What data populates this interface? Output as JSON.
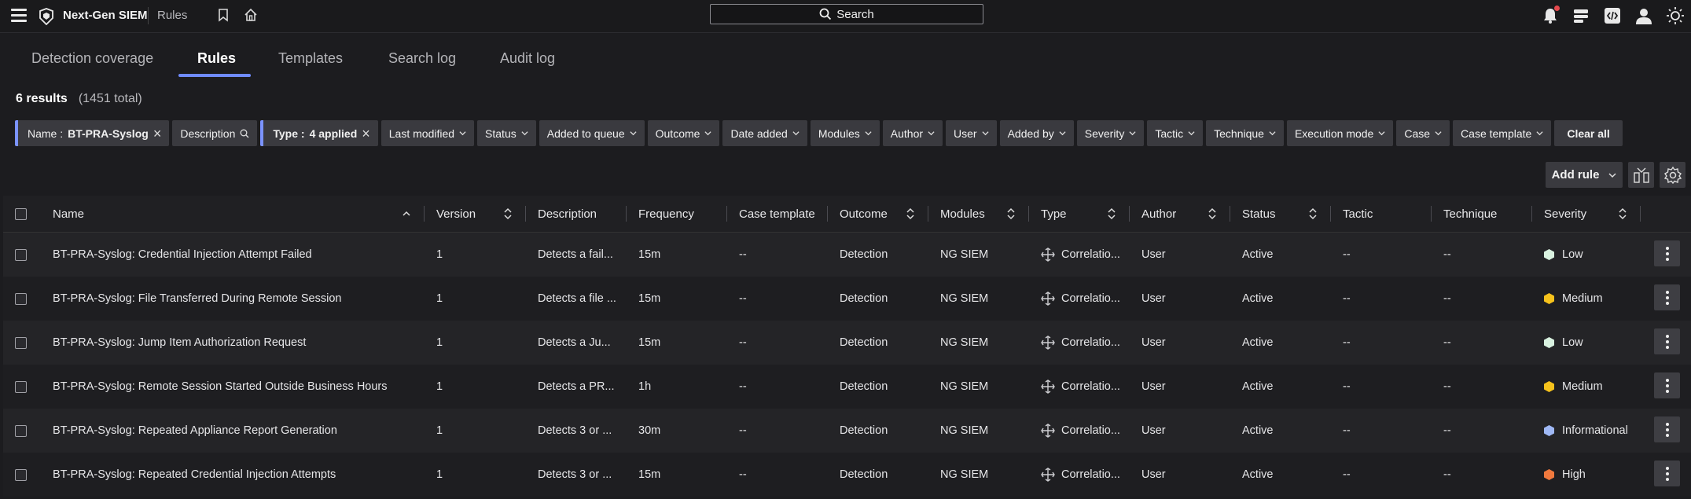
{
  "app": {
    "name": "Next-Gen SIEM",
    "section": "Rules"
  },
  "search": {
    "label": "Search"
  },
  "tabs": [
    {
      "label": "Detection coverage"
    },
    {
      "label": "Rules",
      "active": true
    },
    {
      "label": "Templates"
    },
    {
      "label": "Search log"
    },
    {
      "label": "Audit log"
    }
  ],
  "results": {
    "count": "6 results",
    "total": "(1451 total)"
  },
  "filters": {
    "name_label": "Name :",
    "name_value": "BT-PRA-Syslog",
    "description": "Description",
    "type_label": "Type :",
    "type_value": "4 applied",
    "dropdowns": [
      "Last modified",
      "Status",
      "Added to queue",
      "Outcome",
      "Date added",
      "Modules",
      "Author",
      "User",
      "Added by",
      "Severity",
      "Tactic",
      "Technique",
      "Execution mode",
      "Case",
      "Case template"
    ],
    "clear_all": "Clear all"
  },
  "actions": {
    "add_rule": "Add rule"
  },
  "table": {
    "columns": [
      "Name",
      "Version",
      "Description",
      "Frequency",
      "Case template",
      "Outcome",
      "Modules",
      "Type",
      "Author",
      "Status",
      "Tactic",
      "Technique",
      "Severity"
    ],
    "rows": [
      {
        "name": "BT-PRA-Syslog: Credential Injection Attempt Failed",
        "version": "1",
        "description": "Detects a fail...",
        "frequency": "15m",
        "case_template": "--",
        "outcome": "Detection",
        "modules": "NG SIEM",
        "type": "Correlatio...",
        "author": "User",
        "status": "Active",
        "tactic": "--",
        "technique": "--",
        "severity": "Low",
        "severity_color": "#d9f2e0"
      },
      {
        "name": "BT-PRA-Syslog: File Transferred During Remote Session",
        "version": "1",
        "description": "Detects a file ...",
        "frequency": "15m",
        "case_template": "--",
        "outcome": "Detection",
        "modules": "NG SIEM",
        "type": "Correlatio...",
        "author": "User",
        "status": "Active",
        "tactic": "--",
        "technique": "--",
        "severity": "Medium",
        "severity_color": "#f6c21c"
      },
      {
        "name": "BT-PRA-Syslog: Jump Item Authorization Request",
        "version": "1",
        "description": "Detects a Ju...",
        "frequency": "15m",
        "case_template": "--",
        "outcome": "Detection",
        "modules": "NG SIEM",
        "type": "Correlatio...",
        "author": "User",
        "status": "Active",
        "tactic": "--",
        "technique": "--",
        "severity": "Low",
        "severity_color": "#d9f2e0"
      },
      {
        "name": "BT-PRA-Syslog: Remote Session Started Outside Business Hours",
        "version": "1",
        "description": "Detects a PR...",
        "frequency": "1h",
        "case_template": "--",
        "outcome": "Detection",
        "modules": "NG SIEM",
        "type": "Correlatio...",
        "author": "User",
        "status": "Active",
        "tactic": "--",
        "technique": "--",
        "severity": "Medium",
        "severity_color": "#f6c21c"
      },
      {
        "name": "BT-PRA-Syslog: Repeated Appliance Report Generation",
        "version": "1",
        "description": "Detects 3 or ...",
        "frequency": "30m",
        "case_template": "--",
        "outcome": "Detection",
        "modules": "NG SIEM",
        "type": "Correlatio...",
        "author": "User",
        "status": "Active",
        "tactic": "--",
        "technique": "--",
        "severity": "Informational",
        "severity_color": "#9fb8f5"
      },
      {
        "name": "BT-PRA-Syslog: Repeated Credential Injection Attempts",
        "version": "1",
        "description": "Detects 3 or ...",
        "frequency": "15m",
        "case_template": "--",
        "outcome": "Detection",
        "modules": "NG SIEM",
        "type": "Correlatio...",
        "author": "User",
        "status": "Active",
        "tactic": "--",
        "technique": "--",
        "severity": "High",
        "severity_color": "#f0793e"
      }
    ]
  }
}
